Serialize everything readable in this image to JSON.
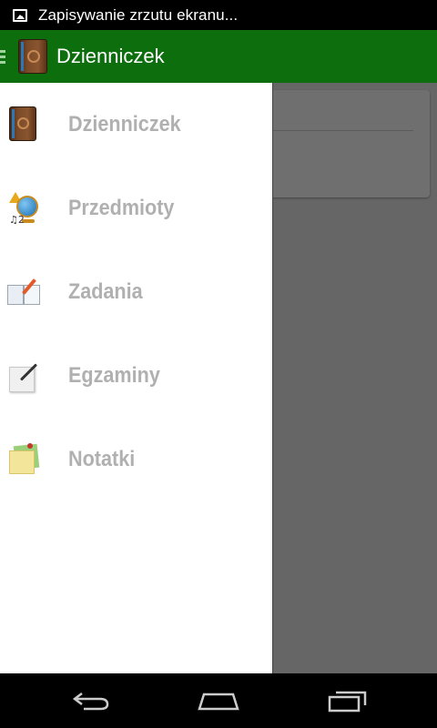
{
  "status_bar": {
    "notification_icon": "image-icon",
    "notification_text": "Zapisywanie zrzutu ekranu..."
  },
  "action_bar": {
    "title": "Dzienniczek",
    "background": "#0c6e0c",
    "app_icon": "diary-book-icon"
  },
  "drawer": {
    "items": [
      {
        "label": "Dzienniczek",
        "icon": "diary-book-icon"
      },
      {
        "label": "Przedmioty",
        "icon": "subjects-globe-icon"
      },
      {
        "label": "Zadania",
        "icon": "homework-notebook-icon"
      },
      {
        "label": "Egzaminy",
        "icon": "exam-paper-icon"
      },
      {
        "label": "Notatki",
        "icon": "sticky-notes-icon"
      }
    ],
    "label_color": "#b0b0b0"
  },
  "system_nav": {
    "back": "back-icon",
    "home": "home-icon",
    "recents": "recent-apps-icon"
  }
}
